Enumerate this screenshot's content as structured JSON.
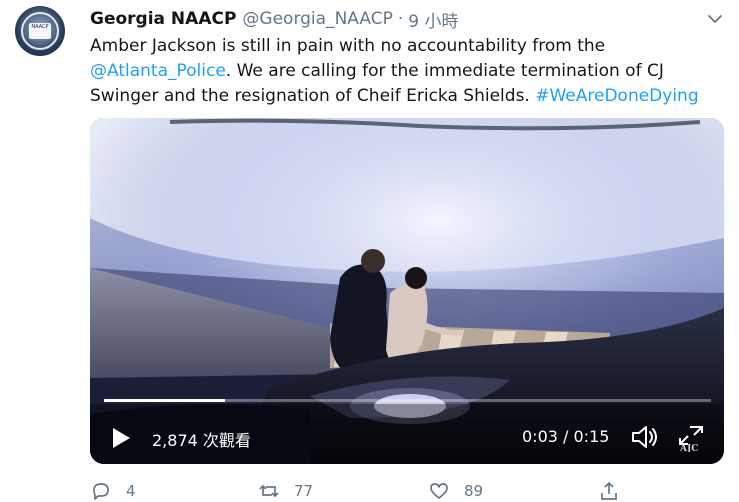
{
  "tweet": {
    "display_name": "Georgia NAACP",
    "handle": "@Georgia_NAACP",
    "separator": "·",
    "time": "9 小時",
    "text": {
      "mention1": "Amber Jackson",
      "part1": " is still in pain with no accountability from the",
      "mention2": "@Atlanta_Police",
      "part2": ". We are calling for the immediate termination of CJ",
      "part3": "Swinger and the resignation of Cheif Ericka Shields. ",
      "hashtag": "#WeAreDoneDying"
    },
    "avatar_text": "NAACP"
  },
  "video": {
    "views": "2,874 次觀看",
    "timer": "0:03 / 0:15",
    "progress": 0.2,
    "watermark": "AJC"
  },
  "actions": {
    "reply_count": "4",
    "retweet_count": "77",
    "like_count": "89"
  },
  "colors": {
    "link": "#1da1f2",
    "muted": "#657786",
    "text": "#14171a"
  }
}
